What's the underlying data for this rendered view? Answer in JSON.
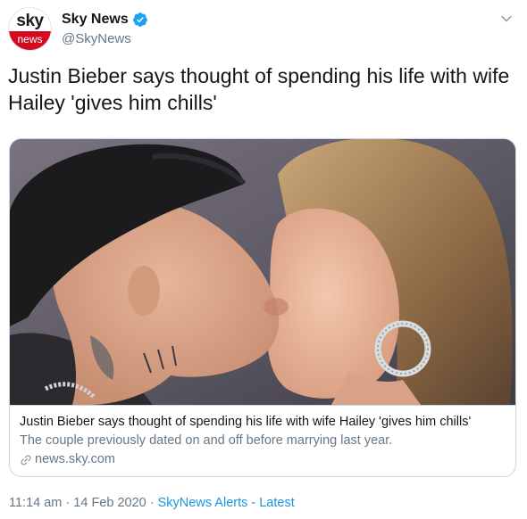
{
  "author": {
    "display_name": "Sky News",
    "handle": "@SkyNews",
    "avatar_top_text": "sky",
    "avatar_bottom_text": "news",
    "verified": true
  },
  "tweet": {
    "text": "Justin Bieber says thought of spending his life with wife Hailey 'gives him chills'"
  },
  "card": {
    "title": "Justin Bieber says thought of spending his life with wife Hailey 'gives him chills'",
    "description": "The couple previously dated on and off before marrying last year.",
    "domain": "news.sky.com"
  },
  "footer": {
    "time": "11:14 am",
    "separator": "·",
    "date": "14 Feb 2020",
    "source": "SkyNews Alerts - Latest"
  },
  "icons": {
    "verified": "verified-badge-icon",
    "caret": "chevron-down-icon",
    "link": "link-icon"
  },
  "colors": {
    "verified_blue": "#1da1f2",
    "link_blue": "#1b95e0",
    "secondary_text": "#657786",
    "sky_red": "#d40a21"
  }
}
